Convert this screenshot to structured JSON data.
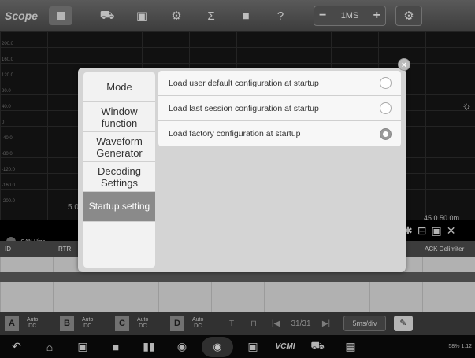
{
  "app": {
    "title": "Scope"
  },
  "toolbar": {
    "timebase_label": "1MS",
    "minus": "−",
    "plus": "+"
  },
  "scope": {
    "y_ticks": [
      "200.0",
      "160.0",
      "120.0",
      "80.0",
      "40.0",
      "0",
      "-40.0",
      "-80.0",
      "-120.0",
      "-160.0",
      "-200.0"
    ],
    "scale_left": "5.0",
    "scale_right": [
      "45.0",
      "50.0m"
    ],
    "channel_label": "-CAN High"
  },
  "decode_table": {
    "columns": [
      "ID",
      "RTR",
      "ACK Delimiter"
    ]
  },
  "channels": [
    {
      "letter": "A",
      "mode": [
        "Auto",
        "DC"
      ]
    },
    {
      "letter": "B",
      "mode": [
        "Auto",
        "DC"
      ]
    },
    {
      "letter": "C",
      "mode": [
        "Auto",
        "DC"
      ]
    },
    {
      "letter": "D",
      "mode": [
        "Auto",
        "DC"
      ]
    }
  ],
  "bottom_bar": {
    "page": "31/31",
    "time_div": "5ms/div"
  },
  "navbar": {
    "vcm_label": "VCMI",
    "status": "58%  1:12"
  },
  "dialog": {
    "menu": [
      {
        "label": "Mode"
      },
      {
        "label": "Window function"
      },
      {
        "label": "Waveform Generator"
      },
      {
        "label": "Decoding Settings"
      },
      {
        "label": "Startup setting"
      }
    ],
    "options": [
      {
        "label": "Load user default configuration at startup",
        "selected": false
      },
      {
        "label": "Load last session configuration at startup",
        "selected": false
      },
      {
        "label": "Load factory configuration at startup",
        "selected": true
      }
    ]
  }
}
